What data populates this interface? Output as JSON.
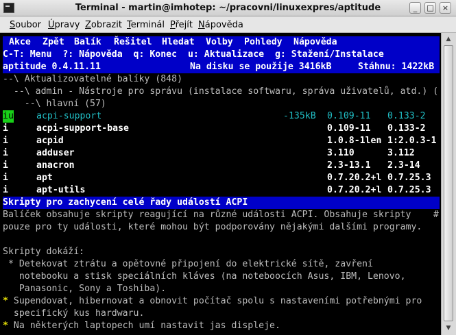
{
  "window": {
    "title": "Terminal - martin@imhotep: ~/pracovni/linuxexpres/aptitude"
  },
  "menubar": [
    "Soubor",
    "Úpravy",
    "Zobrazit",
    "Terminál",
    "Přejít",
    "Nápověda"
  ],
  "aptitude": {
    "menu": [
      "Akce",
      "Zpět",
      "Balík",
      "Řešitel",
      "Hledat",
      "Volby",
      "Pohledy",
      "Nápověda"
    ],
    "keys": "C-T: Menu  ?: Nápověda  q: Konec  u: Aktualizace  g: Stažení/Instalace",
    "status_left": "aptitude 0.4.11.11",
    "status_disk": "Na disku se použije 3416kB",
    "status_download": "Stáhnu: 1422kB",
    "tree": [
      "--\\ Aktualizovatelné balíky (848)",
      "  --\\ admin - Nástroje pro správu (instalace softwaru, správa uživatelů, atd.) (",
      "    --\\ hlavní (57)"
    ],
    "packages": [
      {
        "flag": "iu",
        "name": "acpi-support",
        "size": "-135kB",
        "current": "0.109-11",
        "candidate": "0.133-2",
        "selected": true
      },
      {
        "flag": "i",
        "name": "acpi-support-base",
        "size": "",
        "current": "0.109-11",
        "candidate": "0.133-2"
      },
      {
        "flag": "i",
        "name": "acpid",
        "size": "",
        "current": "1.0.8-1len",
        "candidate": "1:2.0.3-1"
      },
      {
        "flag": "i",
        "name": "adduser",
        "size": "",
        "current": "3.110",
        "candidate": "3.112"
      },
      {
        "flag": "i",
        "name": "anacron",
        "size": "",
        "current": "2.3-13.1",
        "candidate": "2.3-14"
      },
      {
        "flag": "i",
        "name": "apt",
        "size": "",
        "current": "0.7.20.2+l",
        "candidate": "0.7.25.3"
      },
      {
        "flag": "i",
        "name": "apt-utils",
        "size": "",
        "current": "0.7.20.2+l",
        "candidate": "0.7.25.3"
      }
    ],
    "desc_title": "Skripty pro zachycení celé řady událostí ACPI",
    "description": [
      {
        "text": "Balíček obsahuje skripty reagující na různé události ACPI. Obsahuje skripty",
        "tail": "#"
      },
      {
        "text": "pouze pro ty události, které mohou být podporovány nějakými dalšími programy.",
        "tail": ""
      },
      {
        "text": "",
        "tail": ""
      },
      {
        "text": "Skripty dokáží:",
        "tail": ""
      },
      {
        "text": " * Detekovat ztrátu a opětovné připojení do elektrické sítě, zavření",
        "tail": ""
      },
      {
        "text": "   notebooku a stisk speciálních kláves (na noteboocích Asus, IBM, Lenovo,",
        "tail": ""
      },
      {
        "text": "   Panasonic, Sony a Toshiba).",
        "tail": ""
      },
      {
        "text": "* Supendovat, hibernovat a obnovit počítač spolu s nastaveními potřebnými pro",
        "tail": ""
      },
      {
        "text": "  specifický kus hardwaru.",
        "tail": ""
      },
      {
        "text": "* Na některých laptopech umí nastavit jas displeje.",
        "tail": ""
      }
    ]
  }
}
